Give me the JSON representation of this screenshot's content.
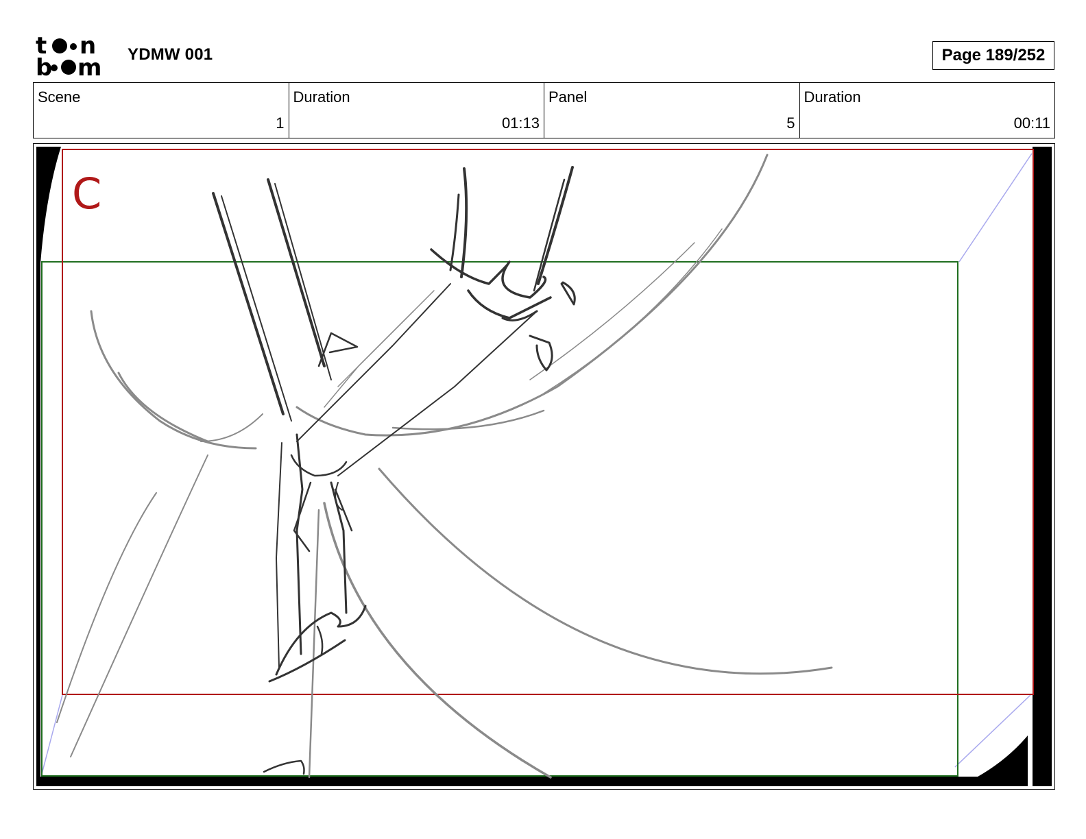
{
  "logo": {
    "line1": "toon",
    "line2": "boom"
  },
  "project_title": "YDMW 001",
  "page_label": "Page 189/252",
  "info": [
    {
      "label": "Scene",
      "value": "1"
    },
    {
      "label": "Duration",
      "value": "01:13"
    },
    {
      "label": "Panel",
      "value": "5"
    },
    {
      "label": "Duration",
      "value": "00:11"
    }
  ],
  "panel": {
    "camera_label": "C",
    "colors": {
      "camera_frame": "#b01818",
      "safe_frame": "#1f6e1f",
      "sketch_dark": "#333333",
      "sketch_light": "#8a8a8a",
      "vignette": "#000000",
      "guide": "#a9a9ee"
    }
  }
}
